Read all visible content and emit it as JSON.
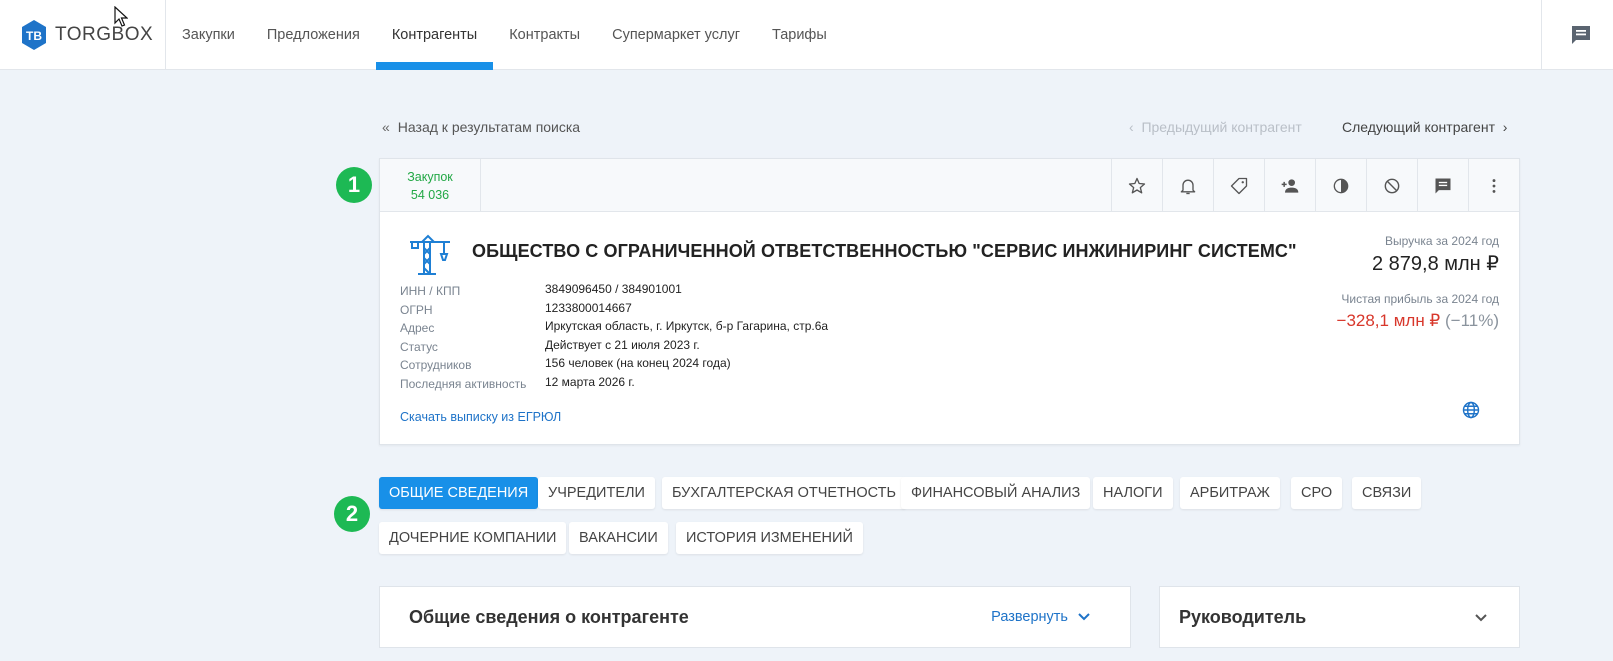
{
  "header": {
    "logo_text_main": "TORGBOX",
    "nav": [
      {
        "label": "Закупки"
      },
      {
        "label": "Предложения"
      },
      {
        "label": "Контрагенты"
      },
      {
        "label": "Контракты"
      },
      {
        "label": "Супермаркет услуг"
      },
      {
        "label": "Тарифы"
      }
    ],
    "active_nav_index": 2
  },
  "navigation": {
    "back_label": "Назад к результатам поиска",
    "prev_label": "Предыдущий контрагент",
    "next_label": "Следующий контрагент"
  },
  "card": {
    "purchases_label": "Закупок",
    "purchases_count": "54 036",
    "title": "ОБЩЕСТВО С ОГРАНИЧЕННОЙ ОТВЕТСТВЕННОСТЬЮ \"СЕРВИС ИНЖИНИРИНГ СИСТЕМС\"",
    "info": [
      {
        "label": "ИНН / КПП",
        "value": "3849096450 / 384901001"
      },
      {
        "label": "ОГРН",
        "value": "1233800014667"
      },
      {
        "label": "Адрес",
        "value": "Иркутская область, г. Иркутск, б-р Гагарина, стр.6а"
      },
      {
        "label": "Статус",
        "value": "Действует с 21 июля 2023 г."
      },
      {
        "label": "Сотрудников",
        "value": "156 человек (на конец 2024 года)"
      },
      {
        "label": "Последняя активность",
        "value": "12 марта 2026 г."
      }
    ],
    "egrul_link": "Скачать выписку из ЕГРЮЛ",
    "revenue_label": "Выручка за 2024 год",
    "revenue_value": "2 879,8 млн ₽",
    "profit_label": "Чистая прибыль за 2024 год",
    "profit_value": "−328,1 млн ₽",
    "profit_pct": "(−11%)"
  },
  "steps": {
    "one": "1",
    "two": "2"
  },
  "tabs": [
    {
      "label": "ОБЩИЕ СВЕДЕНИЯ"
    },
    {
      "label": "УЧРЕДИТЕЛИ"
    },
    {
      "label": "БУХГАЛТЕРСКАЯ ОТЧЕТНОСТЬ"
    },
    {
      "label": "ФИНАНСОВЫЙ АНАЛИЗ"
    },
    {
      "label": "НАЛОГИ"
    },
    {
      "label": "АРБИТРАЖ"
    },
    {
      "label": "СРО"
    },
    {
      "label": "СВЯЗИ"
    },
    {
      "label": "ДОЧЕРНИЕ КОМПАНИИ"
    },
    {
      "label": "ВАКАНСИИ"
    },
    {
      "label": "ИСТОРИЯ ИЗМЕНЕНИЙ"
    }
  ],
  "active_tab_index": 0,
  "panels": {
    "general_title": "Общие сведения о контрагенте",
    "expand_label": "Развернуть",
    "director_title": "Руководитель"
  },
  "colors": {
    "accent": "#1890e8",
    "purchases_green": "#22a845",
    "step_badge": "#1db954",
    "negative": "#d8372b"
  },
  "icons": [
    "star-icon",
    "bell-icon",
    "tag-icon",
    "add-person-icon",
    "contrast-icon",
    "block-icon",
    "comment-icon",
    "more-vertical-icon",
    "globe-icon",
    "crane-icon",
    "chat-icon"
  ]
}
